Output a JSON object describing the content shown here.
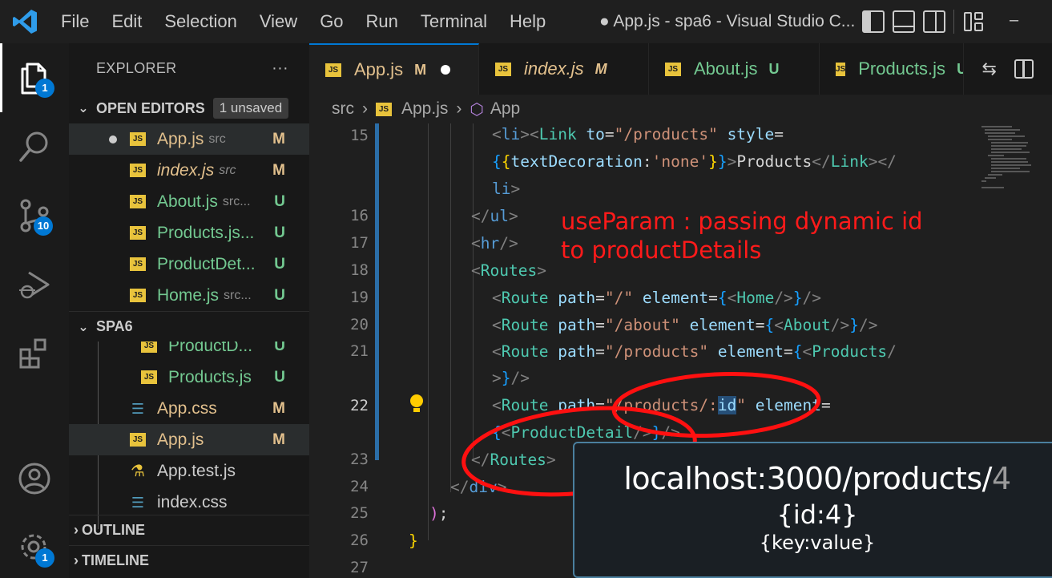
{
  "titlebar": {
    "menu": [
      "File",
      "Edit",
      "Selection",
      "View",
      "Go",
      "Run",
      "Terminal",
      "Help"
    ],
    "window_title": "● App.js - spa6 - Visual Studio C...",
    "minimize_glyph": "–"
  },
  "activity_bar": {
    "explorer_badge": "1",
    "source_control_badge": "10",
    "settings_badge": "1"
  },
  "sidebar": {
    "title": "EXPLORER",
    "more_label": "···",
    "open_editors": {
      "label": "OPEN EDITORS",
      "badge": "1 unsaved",
      "files": [
        {
          "name": "App.js",
          "dir": "src",
          "status": "M"
        },
        {
          "name": "index.js",
          "dir": "src",
          "status": "M"
        },
        {
          "name": "About.js",
          "dir": "src...",
          "status": "U"
        },
        {
          "name": "Products.js...",
          "dir": "",
          "status": "U"
        },
        {
          "name": "ProductDet...",
          "dir": "",
          "status": "U"
        },
        {
          "name": "Home.js",
          "dir": "src...",
          "status": "U"
        }
      ]
    },
    "project": {
      "label": "SPA6",
      "files": [
        {
          "name": "ProductD...",
          "status": "U"
        },
        {
          "name": "Products.js",
          "status": "U"
        },
        {
          "name": "App.css",
          "status": "M"
        },
        {
          "name": "App.js",
          "status": "M"
        },
        {
          "name": "App.test.js",
          "status": ""
        },
        {
          "name": "index.css",
          "status": ""
        }
      ]
    },
    "outline_label": "OUTLINE",
    "timeline_label": "TIMELINE"
  },
  "tabs": [
    {
      "name": "App.js",
      "status": "M"
    },
    {
      "name": "index.js",
      "status": "M"
    },
    {
      "name": "About.js",
      "status": "U"
    },
    {
      "name": "Products.js",
      "status": "U"
    }
  ],
  "breadcrumb": {
    "folder": "src",
    "file": "App.js",
    "symbol": "App"
  },
  "editor": {
    "line_numbers": [
      "15",
      "16",
      "17",
      "18",
      "19",
      "20",
      "21",
      "22",
      "23",
      "24",
      "25",
      "26",
      "27"
    ],
    "annotation_line1": "useParam : passing dynamic id",
    "annotation_line2": "to productDetails"
  },
  "callout": {
    "url_main": "localhost:3000/products/",
    "url_id": "4",
    "object_line": "{id:4}",
    "key_value_line": "{key:value}"
  },
  "colors": {
    "accent": "#0078d4",
    "modified": "#e2c08d",
    "untracked": "#73c991",
    "annotation": "#ff1a1a"
  }
}
